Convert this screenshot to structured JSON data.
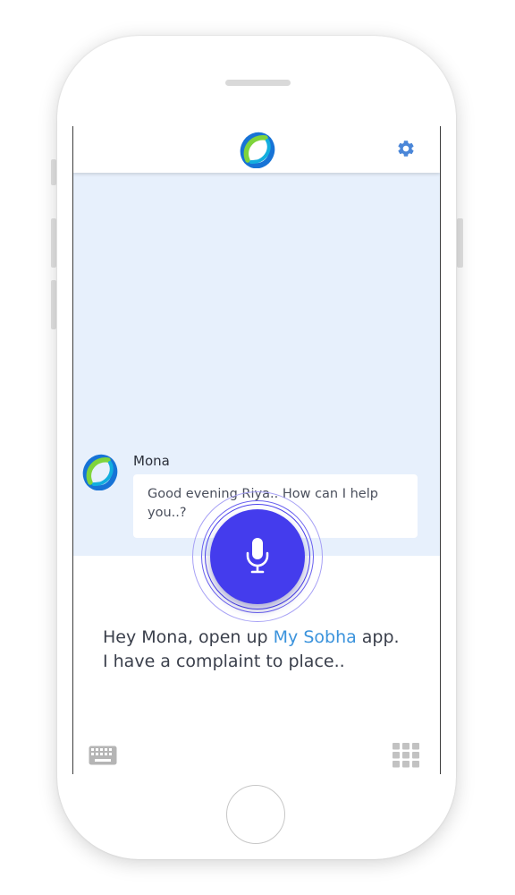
{
  "header": {
    "logo_icon": "assistant-logo-icon",
    "settings_icon": "gear-icon",
    "accent_color": "#4a86d8"
  },
  "chat": {
    "background_color": "#e7f0fc",
    "messages": [
      {
        "sender": "Mona",
        "avatar_icon": "assistant-logo-icon",
        "text": "Good evening Riya.. How can I help you..?"
      }
    ]
  },
  "voice": {
    "mic_icon": "microphone-icon",
    "button_color": "#443ced",
    "transcript_part1": "Hey Mona, open up ",
    "transcript_highlight": "My Sobha",
    "transcript_part2": " app.",
    "transcript_line2": "I have a complaint to place..",
    "highlight_color": "#3b93dc"
  },
  "footer": {
    "keyboard_icon": "keyboard-icon",
    "grid_icon": "grid-menu-icon"
  }
}
